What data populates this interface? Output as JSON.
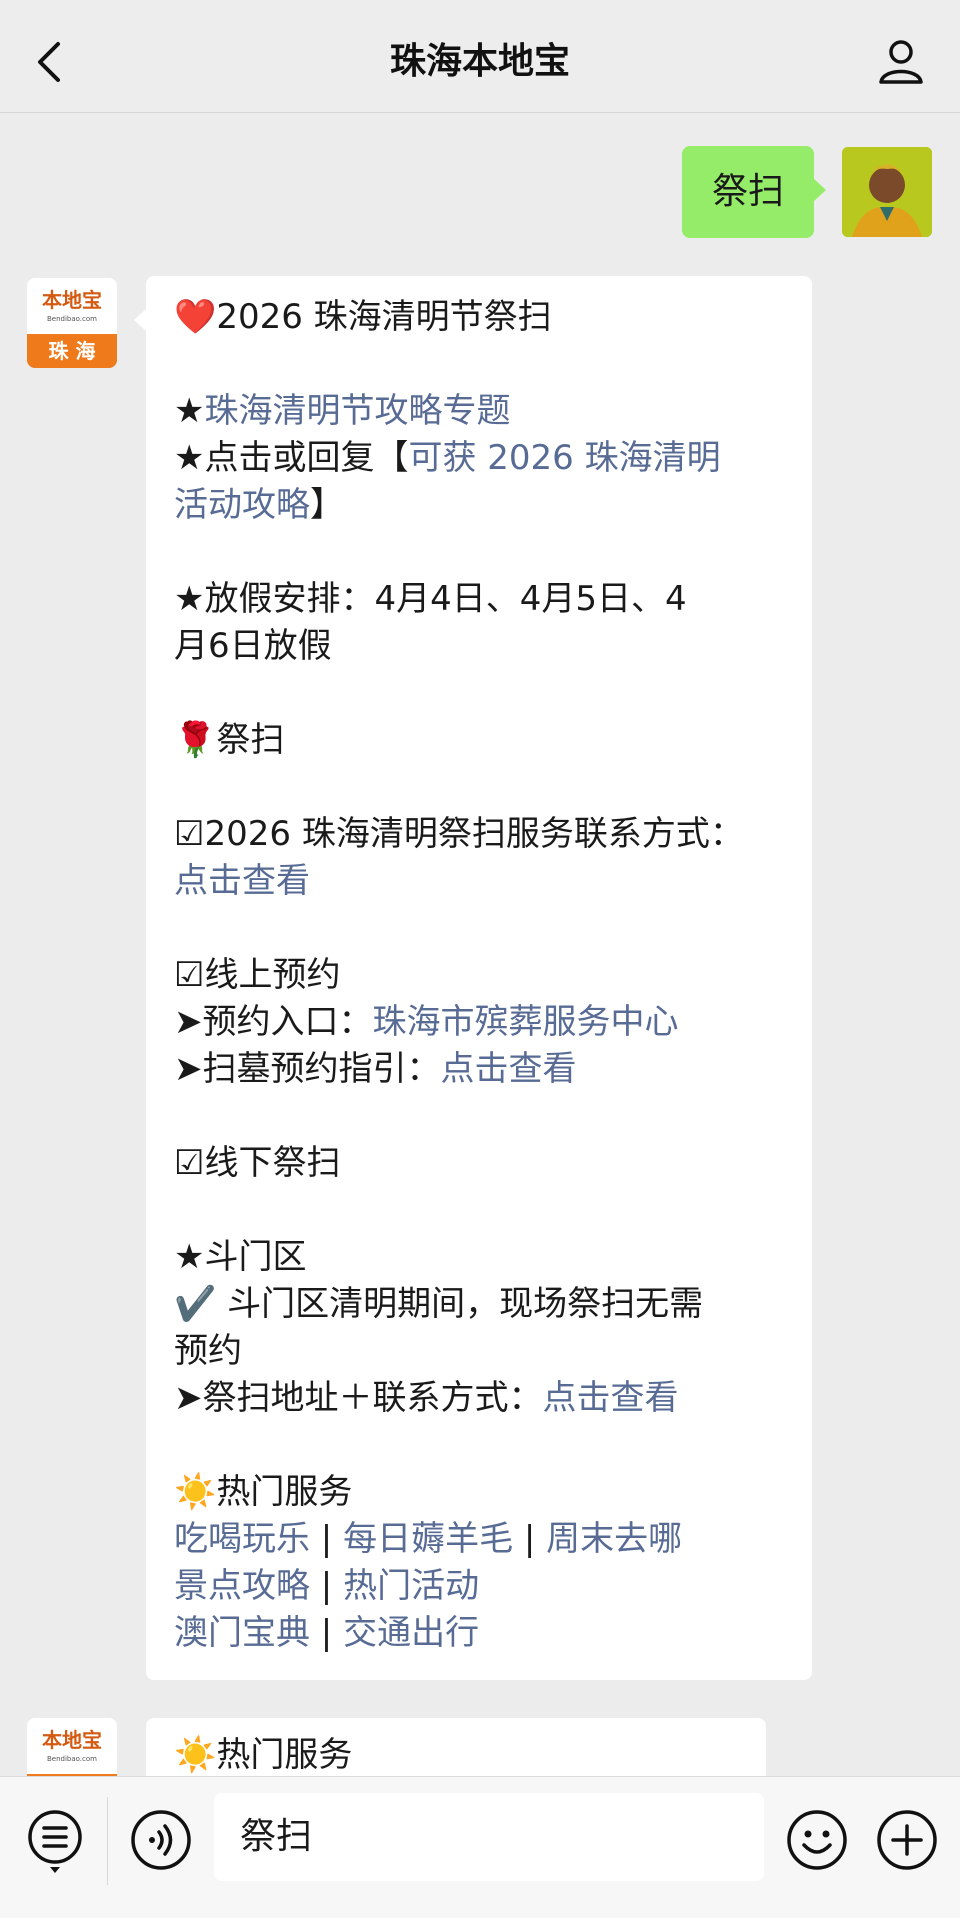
{
  "header": {
    "title": "珠海本地宝"
  },
  "me": {
    "message": "祭扫"
  },
  "bot": {
    "logo_main": "本地宝",
    "logo_sub": "Bendibao.com",
    "logo_city": "珠 海",
    "lines": {
      "l1": "❤️2026 珠海清明节祭扫",
      "l2_star": "★",
      "l2_link": "珠海清明节攻略专题",
      "l3_prefix": "★点击或回复【",
      "l3_link": "可获 2026 珠海清明",
      "l4_link": "活动攻略",
      "l4_suffix": "】",
      "l5": "★放假安排：4月4日、4月5日、4",
      "l6": "月6日放假",
      "l7": "🌹祭扫",
      "l8": "☑2026 珠海清明祭扫服务联系方式：",
      "l9_link": "点击查看",
      "l10": "☑线上预约",
      "l11_prefix": "➤预约入口：",
      "l11_link": "珠海市殡葬服务中心",
      "l12_prefix": "➤扫墓预约指引：",
      "l12_link": "点击查看",
      "l13": "☑线下祭扫",
      "l14": "★斗门区",
      "l15": "✔️ 斗门区清明期间，现场祭扫无需",
      "l16": "预约",
      "l17_prefix": "➤祭扫地址＋联系方式：",
      "l17_link": "点击查看",
      "l18": "☀️热门服务",
      "l19_a": "吃喝玩乐",
      "l19_b": "每日薅羊毛",
      "l19_c": "周末去哪",
      "l20_a": "景点攻略",
      "l20_b": "热门活动",
      "l21_a": "澳门宝典",
      "l21_b": "交通出行",
      "sep": " | "
    },
    "second_line": "☀️热门服务"
  },
  "input": {
    "text": "祭扫"
  },
  "icons": {
    "back": "chevron-left-icon",
    "profile": "person-icon",
    "menu": "menu-icon",
    "voice": "voice-icon",
    "emoji": "emoji-icon",
    "plus": "plus-icon"
  },
  "colors": {
    "link": "#576b95",
    "bubble_me": "#95ec69",
    "logo_orange": "#ef7a1c"
  }
}
